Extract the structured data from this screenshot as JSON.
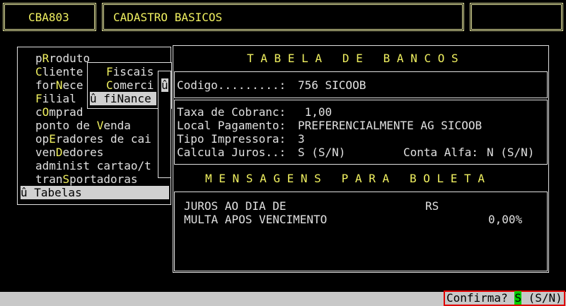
{
  "header": {
    "program_code": "CBA803",
    "program_title": "CADASTRO BASICOS",
    "right_box": ""
  },
  "menu": {
    "items": [
      {
        "pre": "p",
        "hot": "R",
        "post": "roduto"
      },
      {
        "pre": "",
        "hot": "C",
        "post": "liente"
      },
      {
        "pre": "for",
        "hot": "N",
        "post": "ece"
      },
      {
        "pre": "",
        "hot": "F",
        "post": "ilial"
      },
      {
        "pre": "c",
        "hot": "O",
        "post": "mprad"
      },
      {
        "pre": "ponto de ",
        "hot": "V",
        "post": "enda"
      },
      {
        "pre": "op",
        "hot": "E",
        "post": "radores de cai"
      },
      {
        "pre": "ven",
        "hot": "D",
        "post": "edores"
      },
      {
        "pre": "administ cartao/t",
        "hot": "",
        "post": ""
      },
      {
        "pre": "tran",
        "hot": "S",
        "post": "portadoras"
      }
    ],
    "selected": "û Tabelas"
  },
  "submenu": {
    "items": [
      {
        "pre": "",
        "hot": "F",
        "post": "iscais"
      },
      {
        "pre": "",
        "hot": "C",
        "post": "omerci"
      }
    ],
    "selected": "û fiNance",
    "arrow": "û"
  },
  "bank_table": {
    "title": "T A B E L A   D E   B A N C O S",
    "codigo_label": "Codigo.........: ",
    "codigo_value": "756 SICOOB",
    "taxa_label": "Taxa de Cobranc: ",
    "taxa_value": " 1,00",
    "local_label": "Local Pagamento: ",
    "local_value": "PREFERENCIALMENTE AG SICOOB",
    "tipo_label": "Tipo Impressora: ",
    "tipo_value": "3",
    "juros_label": "Calcula Juros..: ",
    "juros_value": "S (S/N)",
    "conta_label": "Conta Alfa: ",
    "conta_value": "N (S/N)"
  },
  "messages": {
    "title": "M E N S A G E N S   P A R A   B O L E T A",
    "line1": "JUROS AO DIA DE",
    "line1_value": "RS",
    "line2": "MULTA APOS VENCIMENTO",
    "line2_value": "0,00%"
  },
  "status": {
    "confirm_label": "Confirma? ",
    "confirm_value": "S",
    "confirm_options": " (S/N)"
  }
}
